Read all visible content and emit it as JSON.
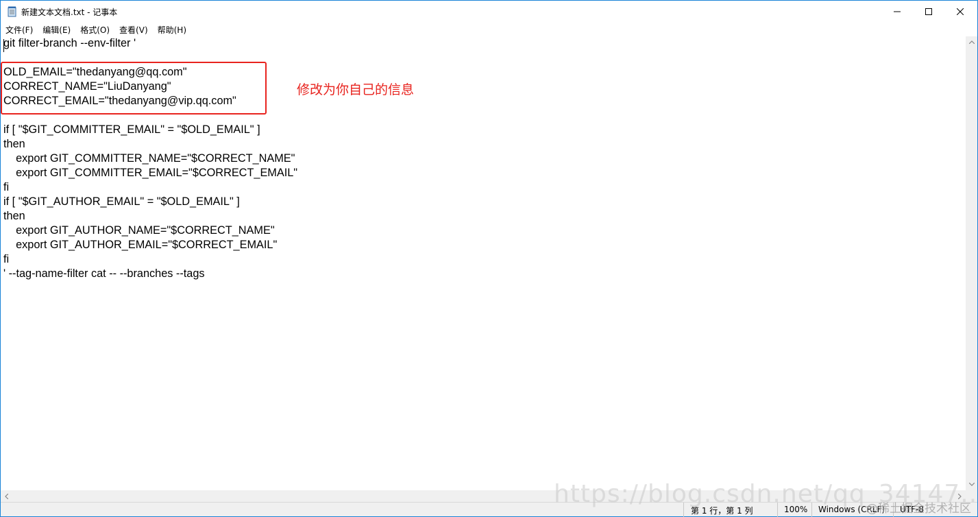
{
  "window": {
    "title": "新建文本文档.txt - 记事本",
    "controls": {
      "minimize_icon": "minimize-icon",
      "maximize_icon": "maximize-icon",
      "close_icon": "close-icon"
    }
  },
  "menu": {
    "items": [
      {
        "label": "文件(F)"
      },
      {
        "label": "编辑(E)"
      },
      {
        "label": "格式(O)"
      },
      {
        "label": "查看(V)"
      },
      {
        "label": "帮助(H)"
      }
    ]
  },
  "editor": {
    "lines": [
      "git filter-branch --env-filter '",
      "",
      "OLD_EMAIL=\"thedanyang@qq.com\"",
      "CORRECT_NAME=\"LiuDanyang\"",
      "CORRECT_EMAIL=\"thedanyang@vip.qq.com\"",
      "",
      "if [ \"$GIT_COMMITTER_EMAIL\" = \"$OLD_EMAIL\" ]",
      "then",
      "    export GIT_COMMITTER_NAME=\"$CORRECT_NAME\"",
      "    export GIT_COMMITTER_EMAIL=\"$CORRECT_EMAIL\"",
      "fi",
      "if [ \"$GIT_AUTHOR_EMAIL\" = \"$OLD_EMAIL\" ]",
      "then",
      "    export GIT_AUTHOR_NAME=\"$CORRECT_NAME\"",
      "    export GIT_AUTHOR_EMAIL=\"$CORRECT_EMAIL\"",
      "fi",
      "' --tag-name-filter cat -- --branches --tags"
    ],
    "annotation": "修改为你自己的信息",
    "annotation_color": "#e8231e"
  },
  "status": {
    "position": "第 1 行，第 1 列",
    "zoom": "100%",
    "line_ending": "Windows (CRLF)",
    "encoding": "UTF-8"
  },
  "watermark": {
    "url": "https://blog.csdn.net/qq_34147...",
    "community": "@稀土掘金技术社区"
  }
}
